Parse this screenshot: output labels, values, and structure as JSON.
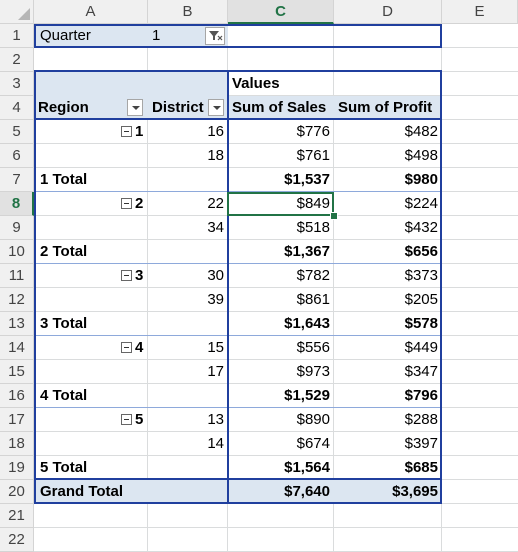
{
  "columns": [
    "A",
    "B",
    "C",
    "D",
    "E"
  ],
  "rows": [
    "1",
    "2",
    "3",
    "4",
    "5",
    "6",
    "7",
    "8",
    "9",
    "10",
    "11",
    "12",
    "13",
    "14",
    "15",
    "16",
    "17",
    "18",
    "19",
    "20",
    "21",
    "22"
  ],
  "active_cell": {
    "column": "C",
    "row": "8"
  },
  "filter": {
    "label": "Quarter",
    "value": "1"
  },
  "pivot": {
    "values_header": "Values",
    "headers": {
      "region": "Region",
      "district": "District",
      "sales": "Sum of Sales",
      "profit": "Sum of Profit"
    },
    "groups": [
      {
        "region": "1",
        "rows": [
          {
            "district": "16",
            "sales": "$776",
            "profit": "$482"
          },
          {
            "district": "18",
            "sales": "$761",
            "profit": "$498"
          }
        ],
        "total_label": "1 Total",
        "total_sales": "$1,537",
        "total_profit": "$980"
      },
      {
        "region": "2",
        "rows": [
          {
            "district": "22",
            "sales": "$849",
            "profit": "$224"
          },
          {
            "district": "34",
            "sales": "$518",
            "profit": "$432"
          }
        ],
        "total_label": "2 Total",
        "total_sales": "$1,367",
        "total_profit": "$656"
      },
      {
        "region": "3",
        "rows": [
          {
            "district": "30",
            "sales": "$782",
            "profit": "$373"
          },
          {
            "district": "39",
            "sales": "$861",
            "profit": "$205"
          }
        ],
        "total_label": "3 Total",
        "total_sales": "$1,643",
        "total_profit": "$578"
      },
      {
        "region": "4",
        "rows": [
          {
            "district": "15",
            "sales": "$556",
            "profit": "$449"
          },
          {
            "district": "17",
            "sales": "$973",
            "profit": "$347"
          }
        ],
        "total_label": "4 Total",
        "total_sales": "$1,529",
        "total_profit": "$796"
      },
      {
        "region": "5",
        "rows": [
          {
            "district": "13",
            "sales": "$890",
            "profit": "$288"
          },
          {
            "district": "14",
            "sales": "$674",
            "profit": "$397"
          }
        ],
        "total_label": "5 Total",
        "total_sales": "$1,564",
        "total_profit": "$685"
      }
    ],
    "grand_total": {
      "label": "Grand Total",
      "sales": "$7,640",
      "profit": "$3,695"
    }
  },
  "colors": {
    "accent": "#217346",
    "pivot_band": "#dce6f1",
    "pivot_border": "#203f9e"
  }
}
